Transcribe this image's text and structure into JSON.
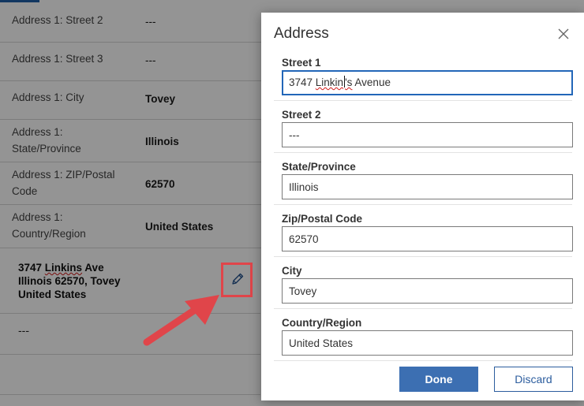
{
  "background_form": {
    "rows": [
      {
        "label": "Address 1: Street 2",
        "value": "---"
      },
      {
        "label": "Address 1: Street 3",
        "value": "---"
      },
      {
        "label": "Address 1: City",
        "value": "Tovey"
      },
      {
        "label": "Address 1: State/Province",
        "value": "Illinois"
      },
      {
        "label": "Address 1: ZIP/Postal Code",
        "value": "62570"
      },
      {
        "label": "Address 1: Country/Region",
        "value": "United States"
      }
    ],
    "composite_address": {
      "line1_prefix": "3747 ",
      "line1_squiggle": "Linkins",
      "line1_suffix": " Ave",
      "line2": "Illinois 62570, Tovey",
      "line3": "United States"
    },
    "empty_value": "---",
    "edit_icon": "pencil-icon"
  },
  "dialog": {
    "title": "Address",
    "close_icon": "close-icon",
    "fields": {
      "street1": {
        "label": "Street 1",
        "value_prefix": "3747 ",
        "value_squiggle_a": "Linkin",
        "value_squiggle_b": "'s",
        "value_suffix": " Avenue"
      },
      "street2": {
        "label": "Street 2",
        "value": "---"
      },
      "state": {
        "label": "State/Province",
        "value": "Illinois"
      },
      "zip": {
        "label": "Zip/Postal Code",
        "value": "62570"
      },
      "city": {
        "label": "City",
        "value": "Tovey"
      },
      "country": {
        "label": "Country/Region",
        "value": "United States"
      }
    },
    "buttons": {
      "done": "Done",
      "discard": "Discard"
    }
  },
  "colors": {
    "accent": "#3c6fb2",
    "focus_border": "#2266b8",
    "annotation_red": "#e0454a"
  }
}
